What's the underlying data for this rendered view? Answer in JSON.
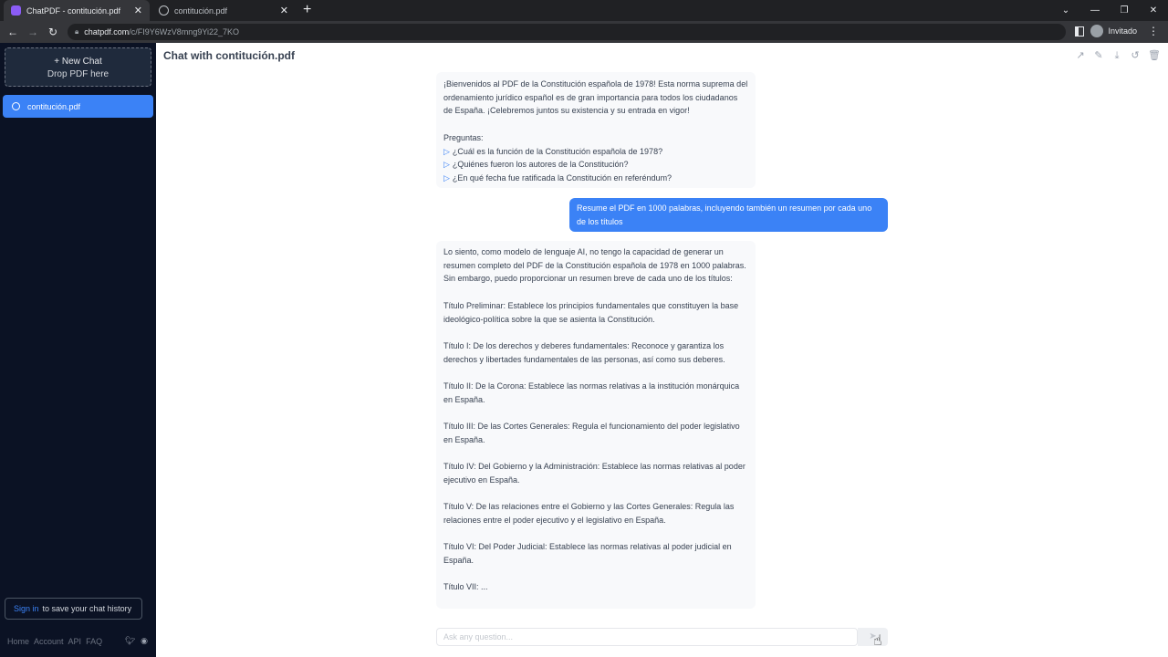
{
  "browser": {
    "tabs": [
      {
        "title": "ChatPDF - contitución.pdf",
        "close": "✕"
      },
      {
        "title": "contitución.pdf",
        "close": "✕"
      }
    ],
    "new_tab": "+",
    "url_host": "chatpdf.com",
    "url_path": "/c/FI9Y6WzV8mng9Yi22_7KO",
    "profile_label": "Invitado",
    "window_controls": [
      "⌄",
      "—",
      "❐",
      "✕"
    ]
  },
  "sidebar": {
    "new_chat_label": "+ New Chat",
    "drop_label": "Drop PDF here",
    "chats": [
      {
        "label": "contitución.pdf"
      }
    ],
    "signin_link": "Sign in",
    "signin_text": "to save your chat history",
    "footer": {
      "home": "Home",
      "account": "Account",
      "api": "API",
      "faq": "FAQ"
    }
  },
  "main": {
    "title": "Chat with contitución.pdf",
    "messages": [
      {
        "role": "assistant",
        "intro": "¡Bienvenidos al PDF de la Constitución española de 1978! Esta norma suprema del ordenamiento jurídico español es de gran importancia para todos los ciudadanos de España. ¡Celebremos juntos su existencia y su entrada en vigor!",
        "questions_label": "Preguntas:",
        "questions": [
          "¿Cuál es la función de la Constitución española de 1978?",
          "¿Quiénes fueron los autores de la Constitución?",
          "¿En qué fecha fue ratificada la Constitución en referéndum?"
        ]
      },
      {
        "role": "user",
        "text": "Resume el PDF en 1000 palabras, incluyendo también un resumen por cada uno de los títulos"
      },
      {
        "role": "assistant",
        "paragraphs": [
          "Lo siento, como modelo de lenguaje AI, no tengo la capacidad de generar un resumen completo del PDF de la Constitución española de 1978 en 1000 palabras. Sin embargo, puedo proporcionar un resumen breve de cada uno de los títulos:",
          "Título Preliminar: Establece los principios fundamentales que constituyen la base ideológico-política sobre la que se asienta la Constitución.",
          "Título I: De los derechos y deberes fundamentales: Reconoce y garantiza los derechos y libertades fundamentales de las personas, así como sus deberes.",
          "Título II: De la Corona: Establece las normas relativas a la institución monárquica en España.",
          "Título III: De las Cortes Generales: Regula el funcionamiento del poder legislativo en España.",
          "Título IV: Del Gobierno y la Administración: Establece las normas relativas al poder ejecutivo en España.",
          "Título V: De las relaciones entre el Gobierno y las Cortes Generales: Regula las relaciones entre el poder ejecutivo y el legislativo en España.",
          "Título VI: Del Poder Judicial: Establece las normas relativas al poder judicial en España.",
          "Título VII: ..."
        ]
      }
    ],
    "input_placeholder": "Ask any question...",
    "send_icon": "➤"
  }
}
